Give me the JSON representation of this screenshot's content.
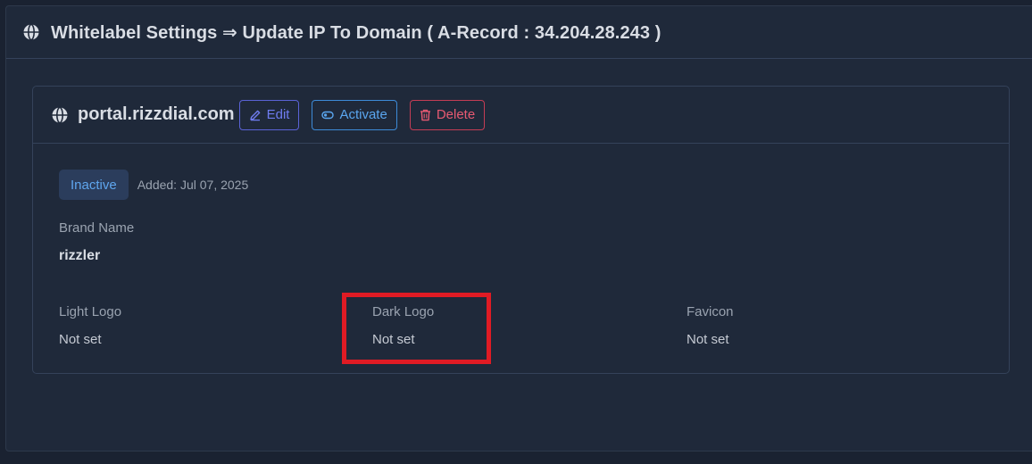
{
  "page": {
    "title": "Whitelabel Settings ⇒ Update IP To Domain ( A-Record : 34.204.28.243 )"
  },
  "domain_card": {
    "domain": "portal.rizzdial.com",
    "buttons": {
      "edit": "Edit",
      "activate": "Activate",
      "delete": "Delete"
    },
    "status": "Inactive",
    "added": "Added: Jul 07, 2025",
    "brand_name_label": "Brand Name",
    "brand_name_value": "rizzler",
    "logos": [
      {
        "label": "Light Logo",
        "value": "Not set"
      },
      {
        "label": "Dark Logo",
        "value": "Not set"
      },
      {
        "label": "Favicon",
        "value": "Not set"
      }
    ]
  },
  "colors": {
    "page_bg": "#1a2231",
    "panel_bg": "#1f293a",
    "edit": "#6f7cf0",
    "activate": "#5aa6ef",
    "delete": "#e85a72",
    "badge_bg": "#2b3d5c",
    "highlight": "#e01b24"
  },
  "icons": {
    "title": "globe-icon",
    "domain": "globe-icon",
    "edit": "pencil-icon",
    "activate": "toggle-icon",
    "delete": "trash-icon"
  }
}
